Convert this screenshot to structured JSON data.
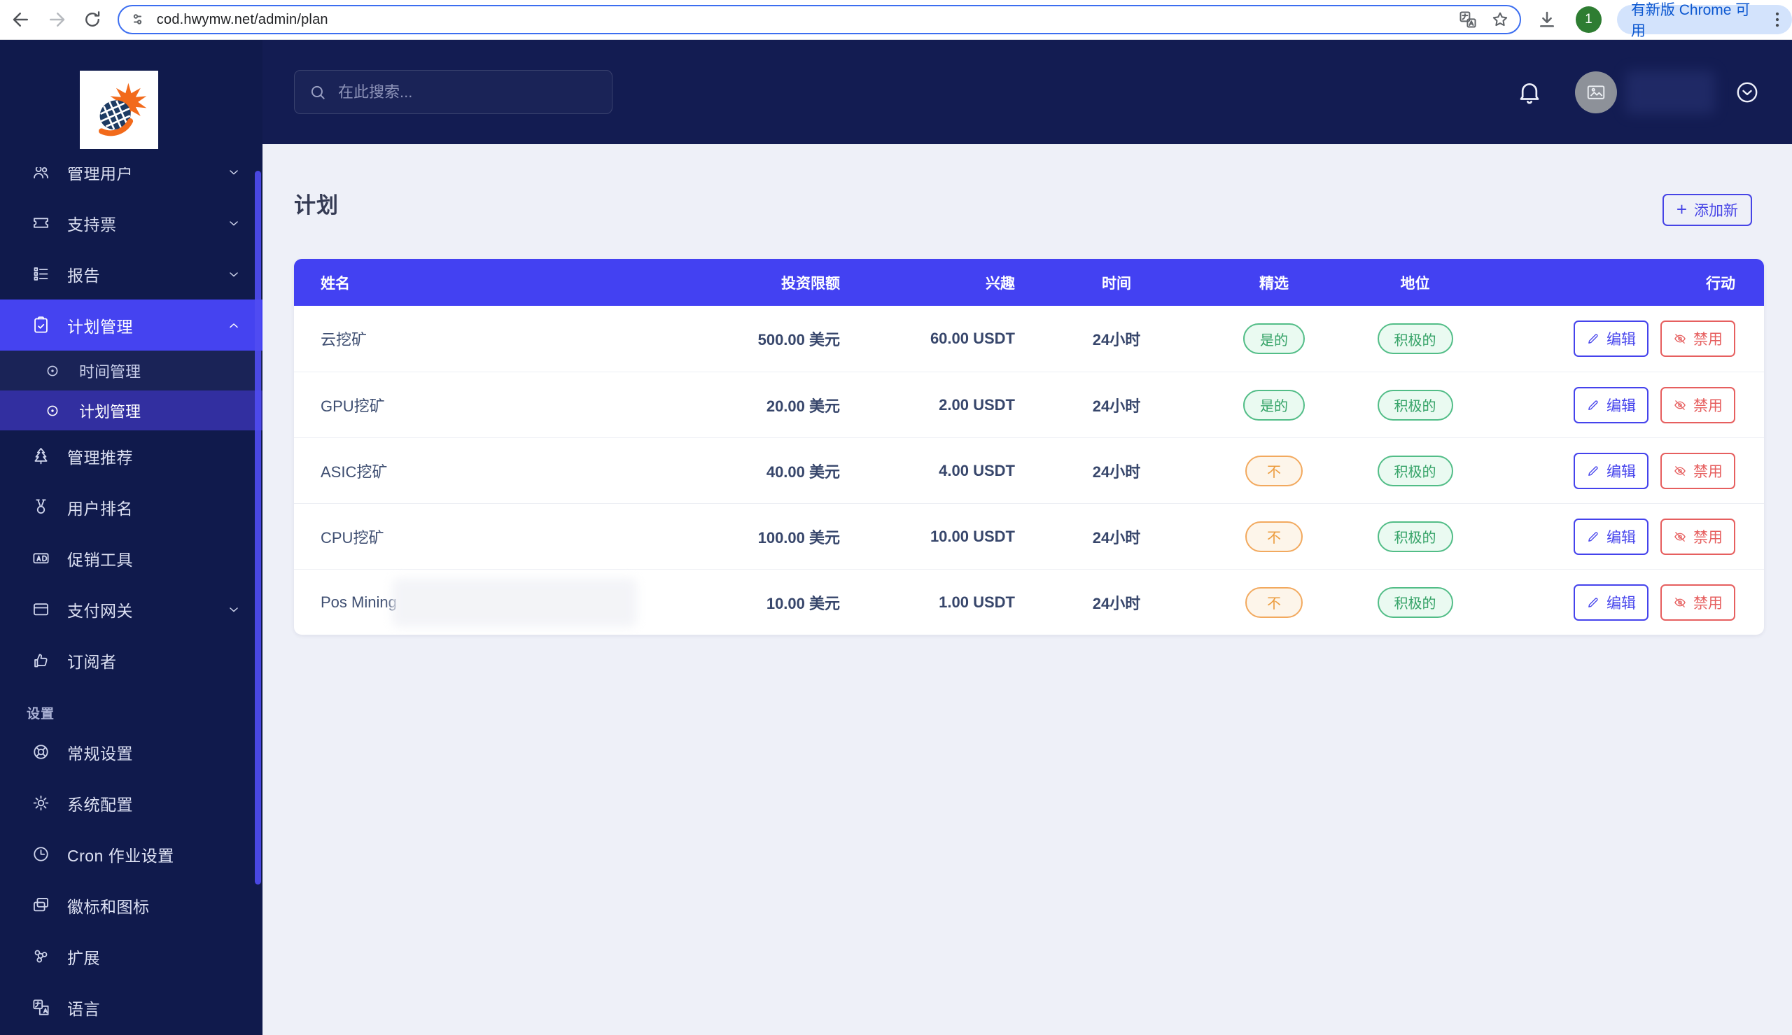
{
  "colors": {
    "accent": "#4543f0",
    "table_header": "#4341f2",
    "sidebar_bg": "#101a4c",
    "green": "#36a368",
    "orange": "#ec9c3e",
    "red": "#e65f5f"
  },
  "browser": {
    "url": "cod.hwymw.net/admin/plan",
    "profile_badge": "1",
    "update_pill": "有新版 Chrome 可用"
  },
  "topbar": {
    "search_placeholder": "在此搜索..."
  },
  "sidebar": {
    "items": [
      {
        "type": "item",
        "icon": "users-icon",
        "label": "管理用户",
        "chevron": "down",
        "active": false,
        "clipped": true
      },
      {
        "type": "item",
        "icon": "ticket-icon",
        "label": "支持票",
        "chevron": "down",
        "active": false
      },
      {
        "type": "item",
        "icon": "report-icon",
        "label": "报告",
        "chevron": "down",
        "active": false
      },
      {
        "type": "item",
        "icon": "clipboard-icon",
        "label": "计划管理",
        "chevron": "up",
        "active": true,
        "children": [
          {
            "icon": "dot-icon",
            "label": "时间管理",
            "active": false
          },
          {
            "icon": "dot-icon",
            "label": "计划管理",
            "active": true
          }
        ]
      },
      {
        "type": "item",
        "icon": "tree-icon",
        "label": "管理推荐",
        "chevron": null,
        "active": false
      },
      {
        "type": "item",
        "icon": "medal-icon",
        "label": "用户排名",
        "chevron": null,
        "active": false
      },
      {
        "type": "item",
        "icon": "ad-icon",
        "label": "促销工具",
        "chevron": null,
        "active": false
      },
      {
        "type": "item",
        "icon": "wallet-icon",
        "label": "支付网关",
        "chevron": "down",
        "active": false
      },
      {
        "type": "item",
        "icon": "thumb-icon",
        "label": "订阅者",
        "chevron": null,
        "active": false
      },
      {
        "type": "section",
        "label": "设置"
      },
      {
        "type": "item",
        "icon": "lifebuoy-icon",
        "label": "常规设置",
        "chevron": null,
        "active": false
      },
      {
        "type": "item",
        "icon": "gear-icon",
        "label": "系统配置",
        "chevron": null,
        "active": false
      },
      {
        "type": "item",
        "icon": "clock-icon",
        "label": "Cron 作业设置",
        "chevron": null,
        "active": false
      },
      {
        "type": "item",
        "icon": "images-icon",
        "label": "徽标和图标",
        "chevron": null,
        "active": false
      },
      {
        "type": "item",
        "icon": "nodes-icon",
        "label": "扩展",
        "chevron": null,
        "active": false
      },
      {
        "type": "item",
        "icon": "language-icon",
        "label": "语言",
        "chevron": null,
        "active": false
      }
    ]
  },
  "page": {
    "title": "计划",
    "add_button": "添加新",
    "add_plus": "+"
  },
  "table": {
    "headers": [
      "姓名",
      "投资限额",
      "兴趣",
      "时间",
      "精选",
      "地位",
      "行动"
    ],
    "action_labels": {
      "edit": "编辑",
      "disable": "禁用"
    },
    "rows": [
      {
        "name": "云挖矿",
        "limit": "500.00 美元",
        "interest": "60.00 USDT",
        "time": "24小时",
        "featured": "是的",
        "featured_kind": "green",
        "status": "积极的",
        "status_kind": "green"
      },
      {
        "name": "GPU挖矿",
        "limit": "20.00 美元",
        "interest": "2.00 USDT",
        "time": "24小时",
        "featured": "是的",
        "featured_kind": "green",
        "status": "积极的",
        "status_kind": "green"
      },
      {
        "name": "ASIC挖矿",
        "limit": "40.00 美元",
        "interest": "4.00 USDT",
        "time": "24小时",
        "featured": "不",
        "featured_kind": "orange",
        "status": "积极的",
        "status_kind": "green"
      },
      {
        "name": "CPU挖矿",
        "limit": "100.00 美元",
        "interest": "10.00 USDT",
        "time": "24小时",
        "featured": "不",
        "featured_kind": "orange",
        "status": "积极的",
        "status_kind": "green"
      },
      {
        "name": "Pos Mining",
        "limit": "10.00 美元",
        "interest": "1.00 USDT",
        "time": "24小时",
        "featured": "不",
        "featured_kind": "orange",
        "status": "积极的",
        "status_kind": "green",
        "blurred_note": true
      }
    ]
  }
}
